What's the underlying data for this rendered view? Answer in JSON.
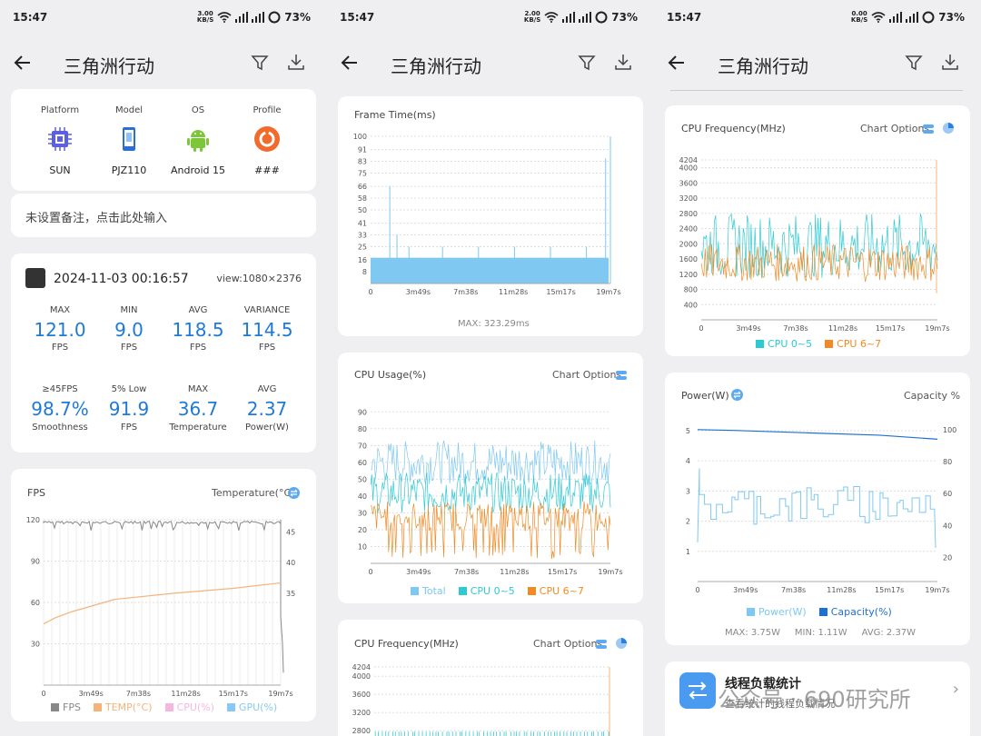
{
  "status": {
    "time": "15:47",
    "battery": "73%",
    "speeds": [
      "3.00",
      "2.00",
      "0.00"
    ],
    "speed_unit": "KB/S"
  },
  "header": {
    "title": "三角洲行动"
  },
  "device": {
    "columns": [
      {
        "label": "Platform",
        "value": "SUN",
        "icon": "chip-icon"
      },
      {
        "label": "Model",
        "value": "PJZ110",
        "icon": "phone-icon"
      },
      {
        "label": "OS",
        "value": "Android 15",
        "icon": "android-icon"
      },
      {
        "label": "Profile",
        "value": "###",
        "icon": "profile-icon"
      }
    ]
  },
  "note": {
    "placeholder": "未设置备注，点击此处输入"
  },
  "session": {
    "datetime": "2024-11-03 00:16:57",
    "view": "view:1080×2376",
    "stats_row1": [
      {
        "label": "MAX",
        "value": "121.0",
        "unit": "FPS"
      },
      {
        "label": "MIN",
        "value": "9.0",
        "unit": "FPS"
      },
      {
        "label": "AVG",
        "value": "118.5",
        "unit": "FPS"
      },
      {
        "label": "VARIANCE",
        "value": "114.5",
        "unit": "FPS"
      }
    ],
    "stats_row2": [
      {
        "label": "≥45FPS",
        "value": "98.7%",
        "unit": "Smoothness"
      },
      {
        "label": "5% Low",
        "value": "91.9",
        "unit": "FPS"
      },
      {
        "label": "MAX",
        "value": "36.7",
        "unit": "Temperature"
      },
      {
        "label": "AVG",
        "value": "2.37",
        "unit": "Power(W)"
      }
    ]
  },
  "x_ticks": [
    "0",
    "3m49s",
    "7m38s",
    "11m28s",
    "15m17s",
    "19m7s"
  ],
  "fps_chart": {
    "title": "FPS",
    "right_title": "Temperature(°C)",
    "left_ticks": [
      "120",
      "90",
      "60",
      "30"
    ],
    "right_ticks": [
      "45",
      "40",
      "35"
    ],
    "legend": [
      {
        "label": "FPS",
        "color": "#888888"
      },
      {
        "label": "TEMP(°C)",
        "color": "#f5b37a"
      },
      {
        "label": "CPU(%)",
        "color": "#f3b8e0"
      },
      {
        "label": "GPU(%)",
        "color": "#89c8f5"
      }
    ]
  },
  "frametime_chart": {
    "title": "Frame Time(ms)",
    "y_ticks": [
      "100",
      "91",
      "83",
      "75",
      "66",
      "58",
      "50",
      "41",
      "33",
      "25",
      "16",
      "8"
    ],
    "footer": "MAX: 323.29ms"
  },
  "cpu_usage_chart": {
    "title": "CPU Usage(%)",
    "options": "Chart Options",
    "y_ticks": [
      "90",
      "80",
      "70",
      "60",
      "50",
      "40",
      "30",
      "20",
      "10"
    ],
    "legend": [
      {
        "label": "Total",
        "color": "#7ec8f2"
      },
      {
        "label": "CPU 0~5",
        "color": "#2ecad3"
      },
      {
        "label": "CPU 6~7",
        "color": "#f08a24"
      }
    ]
  },
  "cpu_freq_chart": {
    "title": "CPU Frequency(MHz)",
    "options": "Chart Options",
    "y_ticks": [
      "4204",
      "4000",
      "3600",
      "3200",
      "2800",
      "2400",
      "2000",
      "1600",
      "1200",
      "800",
      "400"
    ],
    "partial_ticks": [
      "4204",
      "4000",
      "3600",
      "3200",
      "2800"
    ],
    "legend": [
      {
        "label": "CPU 0~5",
        "color": "#2ecad3"
      },
      {
        "label": "CPU 6~7",
        "color": "#f08a24"
      }
    ]
  },
  "power_chart": {
    "title": "Power(W)",
    "right_title": "Capacity %",
    "left_ticks": [
      "5",
      "4",
      "3",
      "2",
      "1"
    ],
    "right_ticks": [
      "100",
      "80",
      "60",
      "40",
      "20"
    ],
    "legend": [
      {
        "label": "Power(W)",
        "color": "#7ec8f2"
      },
      {
        "label": "Capacity(%)",
        "color": "#1f6fd0"
      }
    ],
    "footer": "MAX: 3.75W     MIN: 1.11W     AVG: 2.37W"
  },
  "thread_card": {
    "title": "线程负载统计",
    "subtitle": "查看统计的线程负载情况"
  },
  "watermark": "公众号 · 690研究所"
}
